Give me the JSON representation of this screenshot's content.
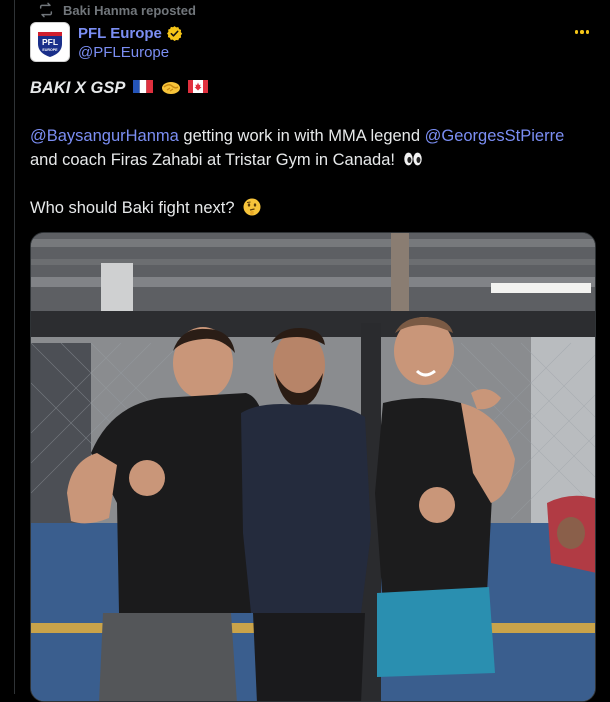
{
  "repost": {
    "text": "Baki Hanma reposted",
    "icon": "repost-icon"
  },
  "author": {
    "display_name": "PFL Europe",
    "handle": "@PFLEurope",
    "verified_color": "#f5c518",
    "avatar_brand_text": "PFL",
    "avatar_sub_text": "EUROPE"
  },
  "tweet": {
    "headline": "BAKI X GSP",
    "line2_mention1": "@BaysangurHanma",
    "line2_text": " getting work in with MMA legend ",
    "line2_mention2": "@GeorgesStPierre",
    "line3_text": "and coach Firas Zahabi at Tristar Gym in Canada!",
    "question": "Who should Baki fight next?"
  },
  "colors": {
    "link": "#7b8ef3",
    "text": "#e7e9ea",
    "muted": "#71767b",
    "background": "#000000"
  }
}
